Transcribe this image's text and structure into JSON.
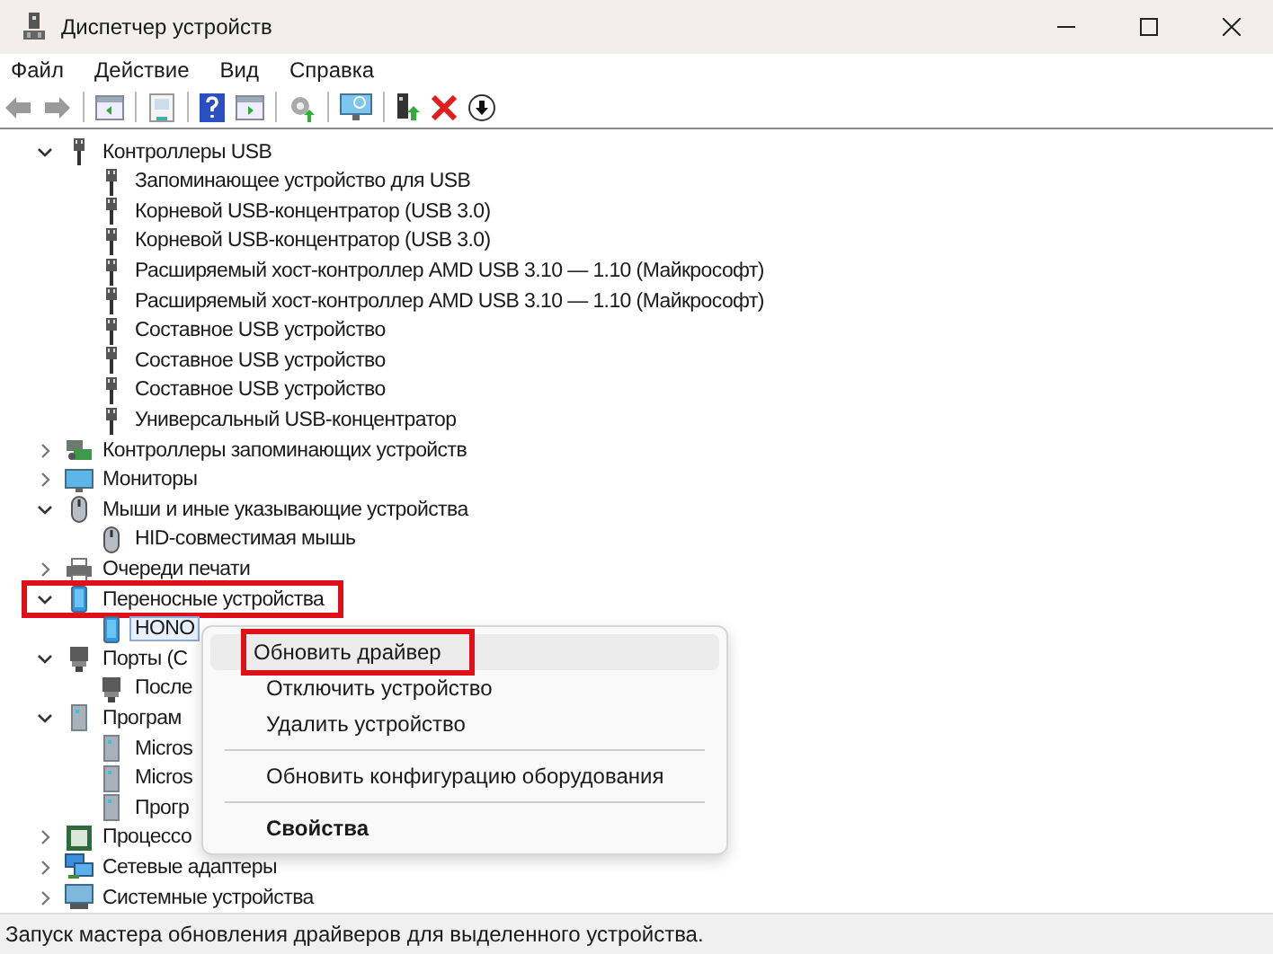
{
  "window": {
    "title": "Диспетчер устройств"
  },
  "menu_bar": [
    "Файл",
    "Действие",
    "Вид",
    "Справка"
  ],
  "tree": [
    {
      "label": "Контроллеры USB",
      "kind": "usb",
      "expanded": true,
      "highlighted": false,
      "children": [
        {
          "label": "Запоминающее устройство для USB",
          "kind": "usb"
        },
        {
          "label": "Корневой USB-концентратор (USB 3.0)",
          "kind": "usb"
        },
        {
          "label": "Корневой USB-концентратор (USB 3.0)",
          "kind": "usb"
        },
        {
          "label": "Расширяемый хост-контроллер AMD USB 3.10 — 1.10 (Майкрософт)",
          "kind": "usb"
        },
        {
          "label": "Расширяемый хост-контроллер AMD USB 3.10 — 1.10 (Майкрософт)",
          "kind": "usb"
        },
        {
          "label": "Составное USB устройство",
          "kind": "usb"
        },
        {
          "label": "Составное USB устройство",
          "kind": "usb"
        },
        {
          "label": "Составное USB устройство",
          "kind": "usb"
        },
        {
          "label": "Универсальный USB-концентратор",
          "kind": "usb"
        }
      ]
    },
    {
      "label": "Контроллеры запоминающих устройств",
      "kind": "storage",
      "expanded": false,
      "highlighted": false
    },
    {
      "label": "Мониторы",
      "kind": "monitor",
      "expanded": false,
      "highlighted": false
    },
    {
      "label": "Мыши и иные указывающие устройства",
      "kind": "mouse",
      "expanded": true,
      "highlighted": false,
      "children": [
        {
          "label": "HID-совместимая мышь",
          "kind": "mouse"
        }
      ]
    },
    {
      "label": "Очереди печати",
      "kind": "printer",
      "expanded": false,
      "highlighted": false
    },
    {
      "label": "Переносные устройства",
      "kind": "phone",
      "expanded": true,
      "highlighted": true,
      "children": [
        {
          "label": "HONO",
          "kind": "phone",
          "selected": true
        }
      ]
    },
    {
      "label": "Порты (C",
      "kind": "port",
      "expanded": true,
      "highlighted": false,
      "children": [
        {
          "label": "После",
          "kind": "port",
          "selected": false
        }
      ]
    },
    {
      "label": "Програм",
      "kind": "software",
      "expanded": true,
      "highlighted": false,
      "children": [
        {
          "label": "Micros",
          "kind": "software",
          "selected": false
        },
        {
          "label": "Micros",
          "kind": "software",
          "selected": false
        },
        {
          "label": "Прогр",
          "kind": "software",
          "selected": false
        }
      ]
    },
    {
      "label": "Процессо",
      "kind": "cpu",
      "expanded": false,
      "highlighted": false
    },
    {
      "label": "Сетевые адаптеры",
      "kind": "network",
      "expanded": false,
      "highlighted": false
    },
    {
      "label": "Системные устройства",
      "kind": "system",
      "expanded": false,
      "highlighted": false
    }
  ],
  "context_menu": [
    {
      "kind": "item",
      "label": "Обновить драйвер",
      "selected": true,
      "highlighted": true,
      "default": false
    },
    {
      "kind": "item",
      "label": "Отключить устройство",
      "selected": false,
      "highlighted": false,
      "default": false
    },
    {
      "kind": "item",
      "label": "Удалить устройство",
      "selected": false,
      "highlighted": false,
      "default": false
    },
    {
      "kind": "separator"
    },
    {
      "kind": "item",
      "label": "Обновить конфигурацию оборудования",
      "selected": false,
      "highlighted": false,
      "default": false
    },
    {
      "kind": "separator"
    },
    {
      "kind": "item",
      "label": "Свойства",
      "selected": false,
      "highlighted": false,
      "default": true
    }
  ],
  "status_bar": "Запуск мастера обновления драйверов для выделенного устройства."
}
